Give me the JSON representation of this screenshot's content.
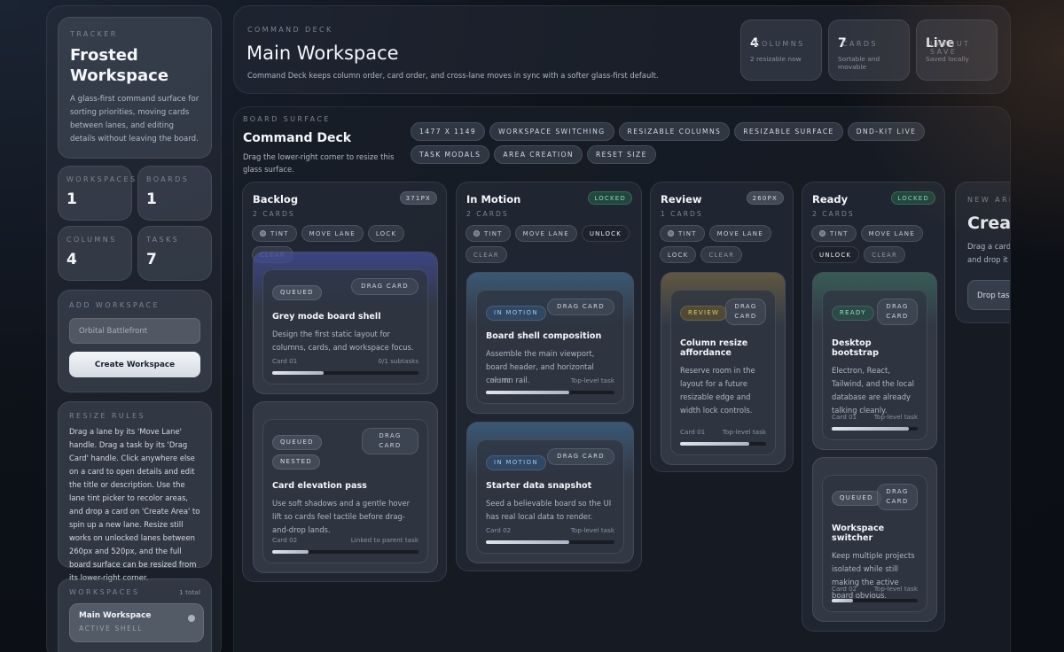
{
  "sidebar": {
    "hero": {
      "eyebrow": "TRACKER",
      "title": "Frosted Workspace",
      "desc": "A glass-first command surface for sorting priorities, moving cards between lanes, and editing details without leaving the board."
    },
    "stats": [
      {
        "label": "WORKSPACES",
        "value": "1"
      },
      {
        "label": "BOARDS",
        "value": "1"
      },
      {
        "label": "COLUMNS",
        "value": "4"
      },
      {
        "label": "TASKS",
        "value": "7"
      }
    ],
    "add_workspace": {
      "eyebrow": "ADD WORKSPACE",
      "placeholder": "Orbital Battlefront",
      "button": "Create Workspace"
    },
    "rules": {
      "eyebrow": "RESIZE RULES",
      "text": "Drag a lane by its 'Move Lane' handle. Drag a task by its 'Drag Card' handle. Click anywhere else on a card to open details and edit the title or description. Use the lane tint picker to recolor areas, and drop a card on 'Create Area' to spin up a new lane. Resize still works on unlocked lanes between 260px and 520px, and the full board surface can be resized from its lower-right corner."
    },
    "workspaces": {
      "eyebrow": "WORKSPACES",
      "count": "1 total",
      "items": [
        {
          "name": "Main Workspace",
          "sub": "ACTIVE SHELL"
        }
      ]
    }
  },
  "header": {
    "eyebrow": "COMMAND DECK",
    "title": "Main Workspace",
    "desc": "Command Deck keeps column order, card order, and cross-lane moves in sync with a softer glass-first default.",
    "stats": [
      {
        "label": "COLUMNS",
        "value": "4",
        "sub": "2 resizable now"
      },
      {
        "label": "CARDS",
        "value": "7",
        "sub": "Sortable and movable"
      },
      {
        "label": "LAYOUT SAVE",
        "value": "Live",
        "sub": "Saved locally"
      }
    ]
  },
  "board": {
    "eyebrow": "BOARD SURFACE",
    "title": "Command Deck",
    "desc": "Drag the lower-right corner to resize this glass surface.",
    "chips": [
      "1477 X 1149",
      "WORKSPACE SWITCHING",
      "RESIZABLE COLUMNS",
      "RESIZABLE SURFACE",
      "DND-KIT LIVE",
      "TASK MODALS",
      "AREA CREATION",
      "RESET SIZE"
    ],
    "lanes": [
      {
        "name": "Backlog",
        "count": "2 CARDS",
        "badge": "371PX",
        "controls": [
          "TINT",
          "MOVE LANE",
          "LOCK",
          "CLEAR"
        ],
        "cards": [
          {
            "tags": [
              "QUEUED"
            ],
            "drag": "DRAG CARD",
            "title": "Grey mode board shell",
            "desc": "Design the first static layout for columns, cards, and workspace focus.",
            "foot_left": "Card 01",
            "foot_right": "0/1 subtasks",
            "progress": 0.35
          },
          {
            "tags": [
              "QUEUED",
              "NESTED"
            ],
            "drag": "DRAG CARD",
            "title": "Card elevation pass",
            "desc": "Use soft shadows and a gentle hover lift so cards feel tactile before drag-and-drop lands.",
            "foot_left": "Card 02",
            "foot_right": "Linked to parent task",
            "progress": 0.25
          }
        ]
      },
      {
        "name": "In Motion",
        "count": "2 CARDS",
        "badge": "LOCKED",
        "controls": [
          "TINT",
          "MOVE LANE",
          "UNLOCK",
          "CLEAR"
        ],
        "cards": [
          {
            "tags": [
              "IN MOTION"
            ],
            "drag": "DRAG CARD",
            "title": "Board shell composition",
            "desc": "Assemble the main viewport, board header, and horizontal column rail.",
            "foot_left": "Card 01",
            "foot_right": "Top-level task",
            "progress": 0.65
          },
          {
            "tags": [
              "IN MOTION"
            ],
            "drag": "DRAG CARD",
            "title": "Starter data snapshot",
            "desc": "Seed a believable board so the UI has real local data to render.",
            "foot_left": "Card 02",
            "foot_right": "Top-level task",
            "progress": 0.65
          }
        ]
      },
      {
        "name": "Review",
        "count": "1 CARDS",
        "badge": "260PX",
        "controls": [
          "TINT",
          "MOVE LANE",
          "LOCK",
          "CLEAR"
        ],
        "cards": [
          {
            "tags": [
              "REVIEW"
            ],
            "drag": "DRAG CARD",
            "title": "Column resize affordance",
            "desc": "Reserve room in the layout for a future resizable edge and width lock controls.",
            "foot_left": "Card 01",
            "foot_right": "Top-level task",
            "progress": 0.8
          }
        ]
      },
      {
        "name": "Ready",
        "count": "2 CARDS",
        "badge": "LOCKED",
        "controls": [
          "TINT",
          "MOVE LANE",
          "UNLOCK",
          "CLEAR"
        ],
        "cards": [
          {
            "tags": [
              "READY"
            ],
            "drag": "DRAG CARD",
            "title": "Desktop bootstrap",
            "desc": "Electron, React, Tailwind, and the local database are already talking cleanly.",
            "foot_left": "Card 01",
            "foot_right": "Top-level task",
            "progress": 0.9
          },
          {
            "tags": [
              "QUEUED"
            ],
            "drag": "DRAG CARD",
            "title": "Workspace switcher",
            "desc": "Keep multiple projects isolated while still making the active board obvious.",
            "foot_left": "Card 02",
            "foot_right": "Top-level task",
            "progress": 0.25
          }
        ]
      }
    ],
    "new_area": {
      "eyebrow": "NEW AREA",
      "title": "Create Area",
      "desc": "Drag a card here to spin up a new lane and drop it in.",
      "button": "Drop task here"
    }
  }
}
